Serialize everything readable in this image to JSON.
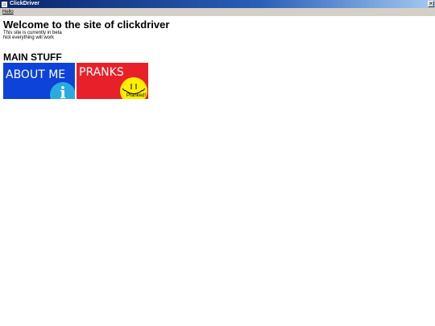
{
  "window": {
    "title": "ClickDriver",
    "close_glyph": "×"
  },
  "menu": {
    "items": [
      {
        "label": "Hello"
      }
    ]
  },
  "page": {
    "title": "Welcome to the site of clickdriver",
    "notes": [
      "This site is currently in beta",
      "Not everything will work"
    ],
    "section_title": "MAIN STUFF"
  },
  "tiles": {
    "about": {
      "label": "ABOUT ME",
      "icon": "info-icon",
      "glyph": "i",
      "color": "#0d43d8"
    },
    "pranks": {
      "label": "PRANKS",
      "icon": "smiley-icon",
      "badge": "Pranked!",
      "color": "#e8202a"
    }
  },
  "colors": {
    "titlebar_start": "#0a246a",
    "menubar": "#d4d0c8",
    "info_circle": "#29abe2",
    "smiley_yellow": "#ffee00"
  }
}
